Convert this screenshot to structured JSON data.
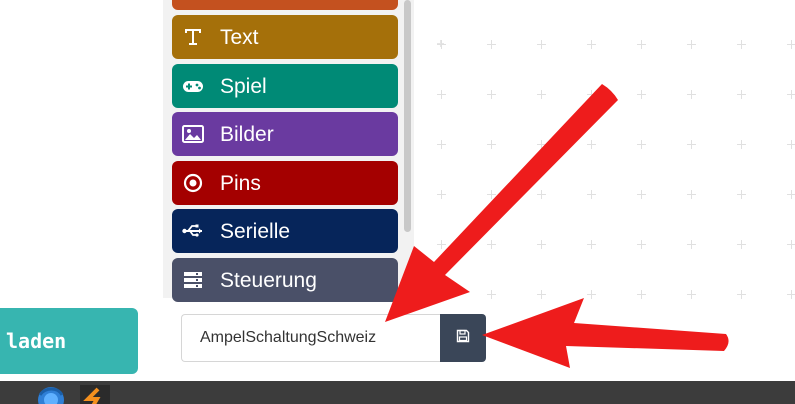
{
  "toolbox": {
    "categories": [
      {
        "label": "Text",
        "icon": "text-format-icon",
        "color": "#a5700a"
      },
      {
        "label": "Spiel",
        "icon": "gamepad-icon",
        "color": "#008a76"
      },
      {
        "label": "Bilder",
        "icon": "image-icon",
        "color": "#6a3aa0"
      },
      {
        "label": "Pins",
        "icon": "target-icon",
        "color": "#a40000"
      },
      {
        "label": "Serielle",
        "icon": "usb-icon",
        "color": "#06255a"
      },
      {
        "label": "Steuerung",
        "icon": "list-icon",
        "color": "#4a5068"
      }
    ],
    "top_category_color": "#c4511f"
  },
  "actions": {
    "load_label": "laden",
    "project_name_value": "AmpelSchaltungSchweiz",
    "save_icon": "save-icon"
  },
  "annotations": {
    "arrow_color": "#ee1c1c"
  },
  "colors": {
    "load_button": "#37b5b0",
    "save_button": "#3a4658",
    "taskbar": "#3c3c3c"
  }
}
